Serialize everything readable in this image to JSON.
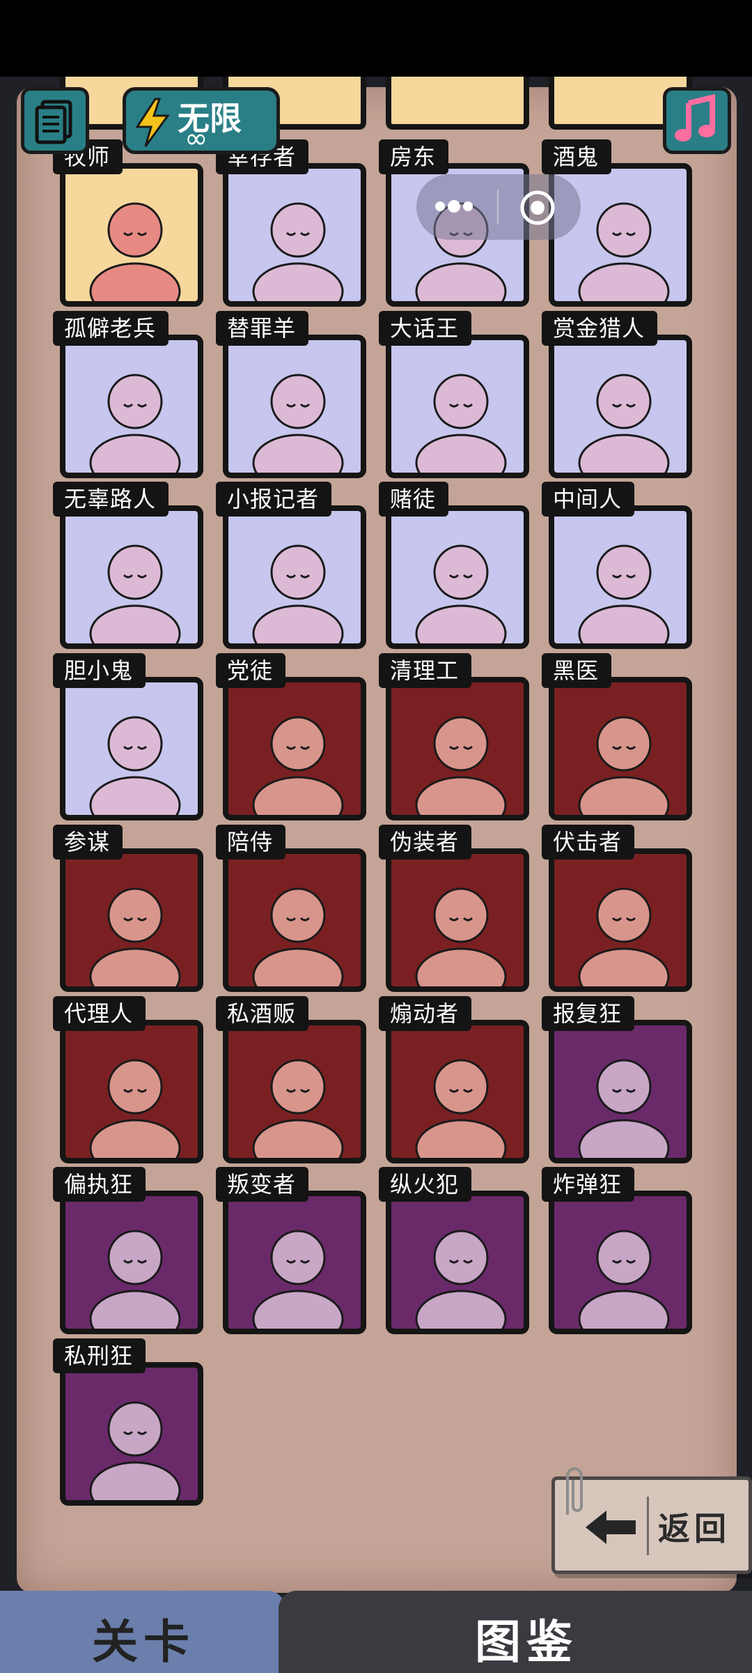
{
  "header": {
    "energy_label": "无限",
    "energy_sub": "∞",
    "doc_icon": "document-stack-icon",
    "music_icon": "music-note-icon",
    "energy_icon": "lightning-icon"
  },
  "capsule": {
    "more_icon": "more-dots-icon",
    "close_icon": "target-close-icon"
  },
  "cards": [
    {
      "label": "牧师",
      "color": "yellow"
    },
    {
      "label": "幸存者",
      "color": "lilac"
    },
    {
      "label": "房东",
      "color": "lilac"
    },
    {
      "label": "酒鬼",
      "color": "lilac"
    },
    {
      "label": "孤僻老兵",
      "color": "lilac"
    },
    {
      "label": "替罪羊",
      "color": "lilac"
    },
    {
      "label": "大话王",
      "color": "lilac"
    },
    {
      "label": "赏金猎人",
      "color": "lilac"
    },
    {
      "label": "无辜路人",
      "color": "lilac"
    },
    {
      "label": "小报记者",
      "color": "lilac"
    },
    {
      "label": "赌徒",
      "color": "lilac"
    },
    {
      "label": "中间人",
      "color": "lilac"
    },
    {
      "label": "胆小鬼",
      "color": "lilac"
    },
    {
      "label": "党徒",
      "color": "red"
    },
    {
      "label": "清理工",
      "color": "red"
    },
    {
      "label": "黑医",
      "color": "red"
    },
    {
      "label": "参谋",
      "color": "red"
    },
    {
      "label": "陪侍",
      "color": "red"
    },
    {
      "label": "伪装者",
      "color": "red"
    },
    {
      "label": "伏击者",
      "color": "red"
    },
    {
      "label": "代理人",
      "color": "red"
    },
    {
      "label": "私酒贩",
      "color": "red"
    },
    {
      "label": "煽动者",
      "color": "red"
    },
    {
      "label": "报复狂",
      "color": "purple"
    },
    {
      "label": "偏执狂",
      "color": "purple"
    },
    {
      "label": "叛变者",
      "color": "purple"
    },
    {
      "label": "纵火犯",
      "color": "purple"
    },
    {
      "label": "炸弹狂",
      "color": "purple"
    },
    {
      "label": "私刑狂",
      "color": "purple"
    }
  ],
  "colors": {
    "yellow": "#f6d79c",
    "lilac": "#c7c6ee",
    "red": "#7a2022",
    "purple": "#6a2a6a",
    "skin_pink": "#e7a0a0",
    "skin_lilac": "#dcbad6"
  },
  "back_button": {
    "label": "返回",
    "icon": "arrow-left-icon"
  },
  "tabs": {
    "levels": "关卡",
    "gallery": "图鉴"
  }
}
